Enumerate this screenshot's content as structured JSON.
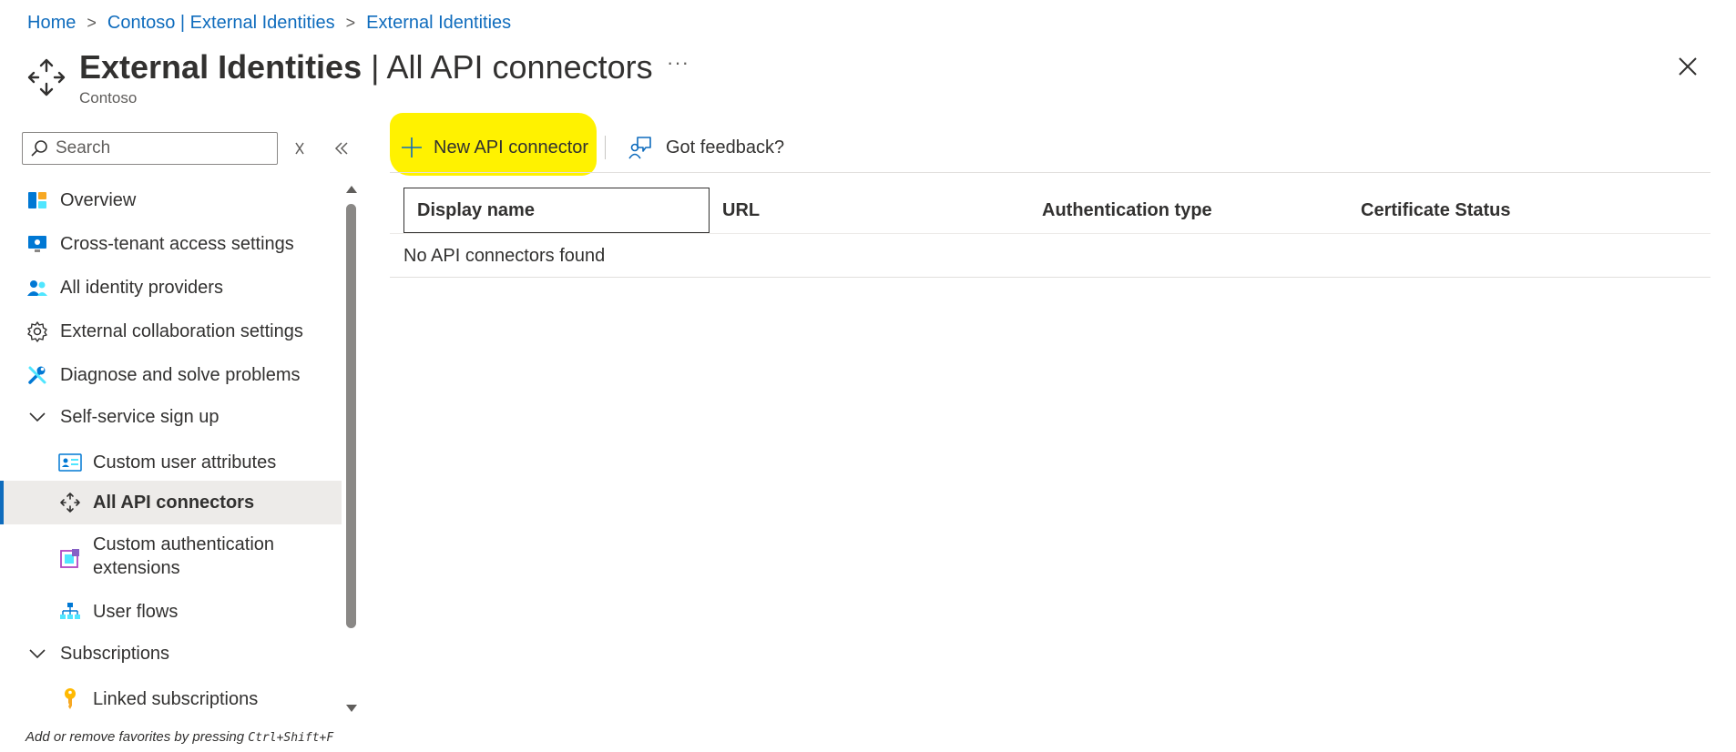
{
  "breadcrumb": {
    "items": [
      "Home",
      "Contoso | External Identities",
      "External Identities"
    ]
  },
  "header": {
    "title_bold": "External Identities",
    "title_rest": " | All API connectors",
    "subtitle": "Contoso",
    "more_label": "···",
    "icon": "api-connector-icon"
  },
  "sidebar": {
    "search_placeholder": "Search",
    "items": [
      {
        "label": "Overview",
        "icon": "overview-icon"
      },
      {
        "label": "Cross-tenant access settings",
        "icon": "monitor-icon"
      },
      {
        "label": "All identity providers",
        "icon": "users-icon"
      },
      {
        "label": "External collaboration settings",
        "icon": "gear-icon"
      },
      {
        "label": "Diagnose and solve problems",
        "icon": "wrench-icon"
      },
      {
        "label": "Self-service sign up",
        "icon": "chevron-down-icon"
      },
      {
        "label": "Custom user attributes",
        "icon": "id-card-icon"
      },
      {
        "label": "All API connectors",
        "icon": "api-connector-icon",
        "active": true
      },
      {
        "label_line1": "Custom authentication",
        "label_line2": "extensions",
        "icon": "extension-icon"
      },
      {
        "label": "User flows",
        "icon": "user-flows-icon"
      },
      {
        "label": "Subscriptions",
        "icon": "chevron-down-icon"
      },
      {
        "label": "Linked subscriptions",
        "icon": "key-icon"
      }
    ],
    "favorites_hint_text": "Add or remove favorites by pressing ",
    "favorites_hint_keys": "Ctrl+Shift+F"
  },
  "toolbar": {
    "new_label": "New API connector",
    "feedback_label": "Got feedback?"
  },
  "table": {
    "columns": [
      "Display name",
      "URL",
      "Authentication type",
      "Certificate Status"
    ],
    "empty_message": "No API connectors found"
  },
  "colors": {
    "link": "#0f6cbd",
    "highlight": "#fff200",
    "active_bg": "#edebe9"
  }
}
